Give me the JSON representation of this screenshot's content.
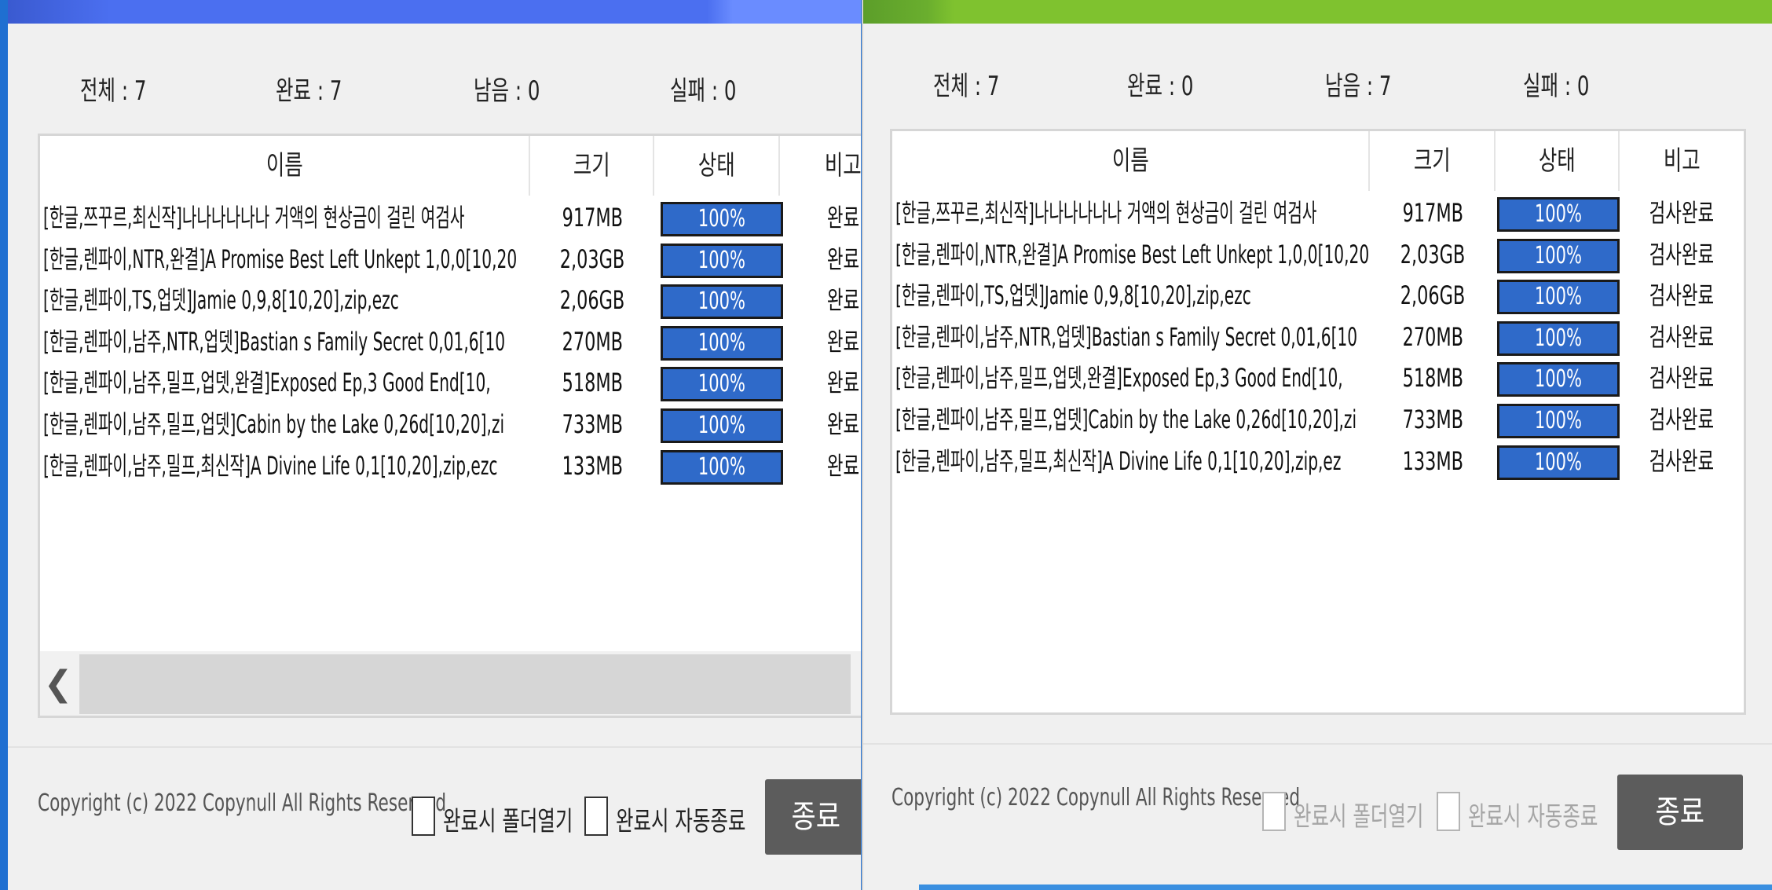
{
  "left_window": {
    "stats": {
      "total": "전체 : 7",
      "done": "완료 : 7",
      "remaining": "남음 : 0",
      "failed": "실패 : 0"
    },
    "columns": {
      "name": "이름",
      "size": "크기",
      "status": "상태",
      "note": "비고"
    },
    "rows": [
      {
        "name": "[한글,쯔꾸르,최신작]나나나나나나 거액의 현상금이 걸린 여검사",
        "size": "917MB",
        "progress": "100%",
        "note": "완료"
      },
      {
        "name": "[한글,렌파이,NTR,완결]A Promise Best Left Unkept 1,0,0[10,20",
        "size": "2,03GB",
        "progress": "100%",
        "note": "완료"
      },
      {
        "name": "[한글,렌파이,TS,업뎃]Jamie 0,9,8[10,20],zip,ezc",
        "size": "2,06GB",
        "progress": "100%",
        "note": "완료"
      },
      {
        "name": "[한글,렌파이,남주,NTR,업뎃]Bastian s Family Secret 0,01,6[10",
        "size": "270MB",
        "progress": "100%",
        "note": "완료"
      },
      {
        "name": "[한글,렌파이,남주,밀프,업뎃,완결]Exposed Ep,3 Good End[10,",
        "size": "518MB",
        "progress": "100%",
        "note": "완료"
      },
      {
        "name": "[한글,렌파이,남주,밀프,업뎃]Cabin by the Lake 0,26d[10,20],zi",
        "size": "733MB",
        "progress": "100%",
        "note": "완료"
      },
      {
        "name": "[한글,렌파이,남주,밀프,최신작]A Divine Life 0,1[10,20],zip,ezc",
        "size": "133MB",
        "progress": "100%",
        "note": "완료"
      }
    ],
    "scroll_left_icon": "chevron-left-icon",
    "copyright": "Copyright (c) 2022 Copynull All Rights Reserved",
    "open_folder_label": "완료시 폴더열기",
    "auto_exit_label": "완료시 자동종료",
    "close_label": "종료"
  },
  "right_window": {
    "stats": {
      "total": "전체 : 7",
      "done": "완료 : 0",
      "remaining": "남음 : 7",
      "failed": "실패 : 0"
    },
    "columns": {
      "name": "이름",
      "size": "크기",
      "status": "상태",
      "note": "비고"
    },
    "rows": [
      {
        "name": "[한글,쯔꾸르,최신작]나나나나나나 거액의 현상금이 걸린 여검사",
        "size": "917MB",
        "progress": "100%",
        "note": "검사완료"
      },
      {
        "name": "[한글,렌파이,NTR,완결]A Promise Best Left Unkept 1,0,0[10,20",
        "size": "2,03GB",
        "progress": "100%",
        "note": "검사완료"
      },
      {
        "name": "[한글,렌파이,TS,업뎃]Jamie 0,9,8[10,20],zip,ezc",
        "size": "2,06GB",
        "progress": "100%",
        "note": "검사완료"
      },
      {
        "name": "[한글,렌파이,남주,NTR,업뎃]Bastian s Family Secret 0,01,6[10",
        "size": "270MB",
        "progress": "100%",
        "note": "검사완료"
      },
      {
        "name": "[한글,렌파이,남주,밀프,업뎃,완결]Exposed Ep,3 Good End[10,",
        "size": "518MB",
        "progress": "100%",
        "note": "검사완료"
      },
      {
        "name": "[한글,렌파이,남주,밀프,업뎃]Cabin by the Lake 0,26d[10,20],zi",
        "size": "733MB",
        "progress": "100%",
        "note": "검사완료"
      },
      {
        "name": "[한글,렌파이,남주,밀프,최신작]A Divine Life 0,1[10,20],zip,ez",
        "size": "133MB",
        "progress": "100%",
        "note": "검사완료"
      }
    ],
    "copyright": "Copyright (c) 2022 Copynull All Rights Reserved",
    "open_folder_label": "완료시 폴더열기",
    "auto_exit_label": "완료시 자동종료",
    "close_label": "종료"
  }
}
